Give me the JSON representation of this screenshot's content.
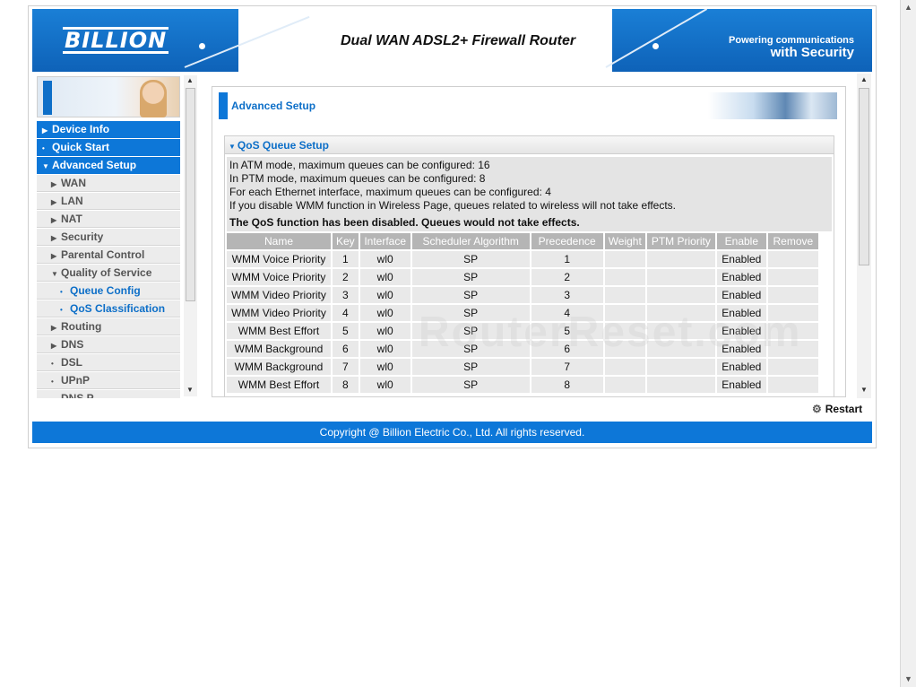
{
  "header": {
    "logo": "BILLION",
    "title": "Dual WAN ADSL2+ Firewall Router",
    "tagline_line1": "Powering communications",
    "tagline_line2": "with Security"
  },
  "menu": {
    "items": [
      {
        "label": "Device Info",
        "level": "top",
        "glyph": "▶"
      },
      {
        "label": "Quick Start",
        "level": "top",
        "glyph": "•"
      },
      {
        "label": "Advanced Setup",
        "level": "top",
        "glyph": "▼"
      },
      {
        "label": "WAN",
        "level": "sub",
        "glyph": "▶"
      },
      {
        "label": "LAN",
        "level": "sub",
        "glyph": "▶"
      },
      {
        "label": "NAT",
        "level": "sub",
        "glyph": "▶"
      },
      {
        "label": "Security",
        "level": "sub",
        "glyph": "▶"
      },
      {
        "label": "Parental Control",
        "level": "sub",
        "glyph": "▶"
      },
      {
        "label": "Quality of Service",
        "level": "sub",
        "glyph": "▼"
      },
      {
        "label": "Queue Config",
        "level": "sub2",
        "glyph": "•"
      },
      {
        "label": "QoS Classification",
        "level": "sub2",
        "glyph": "•"
      },
      {
        "label": "Routing",
        "level": "sub",
        "glyph": "▶"
      },
      {
        "label": "DNS",
        "level": "sub",
        "glyph": "▶"
      },
      {
        "label": "DSL",
        "level": "sub",
        "glyph": "•"
      },
      {
        "label": "UPnP",
        "level": "sub",
        "glyph": "•"
      },
      {
        "label": "DNS P",
        "level": "sub",
        "glyph": "•"
      }
    ]
  },
  "content": {
    "section_title": "Advanced Setup",
    "qos_title": "QoS Queue Setup",
    "info_lines": [
      "In ATM mode, maximum queues can be configured: 16",
      "In PTM mode, maximum queues can be configured: 8",
      "For each Ethernet interface, maximum queues can be configured: 4",
      "If you disable WMM function in Wireless Page, queues related to wireless will not take effects."
    ],
    "warning": "The QoS function has been disabled. Queues would not take effects.",
    "watermark": "RouterReset.com"
  },
  "table": {
    "headers": [
      "Name",
      "Key",
      "Interface",
      "Scheduler Algorithm",
      "Precedence",
      "Weight",
      "PTM Priority",
      "Enable",
      "Remove"
    ],
    "rows": [
      [
        "WMM Voice Priority",
        "1",
        "wl0",
        "SP",
        "1",
        "",
        "",
        "Enabled",
        ""
      ],
      [
        "WMM Voice Priority",
        "2",
        "wl0",
        "SP",
        "2",
        "",
        "",
        "Enabled",
        ""
      ],
      [
        "WMM Video Priority",
        "3",
        "wl0",
        "SP",
        "3",
        "",
        "",
        "Enabled",
        ""
      ],
      [
        "WMM Video Priority",
        "4",
        "wl0",
        "SP",
        "4",
        "",
        "",
        "Enabled",
        ""
      ],
      [
        "WMM Best Effort",
        "5",
        "wl0",
        "SP",
        "5",
        "",
        "",
        "Enabled",
        ""
      ],
      [
        "WMM Background",
        "6",
        "wl0",
        "SP",
        "6",
        "",
        "",
        "Enabled",
        ""
      ],
      [
        "WMM Background",
        "7",
        "wl0",
        "SP",
        "7",
        "",
        "",
        "Enabled",
        ""
      ],
      [
        "WMM Best Effort",
        "8",
        "wl0",
        "SP",
        "8",
        "",
        "",
        "Enabled",
        ""
      ]
    ]
  },
  "actions": {
    "restart": "Restart"
  },
  "footer": {
    "copyright": "Copyright @ Billion Electric Co., Ltd. All rights reserved."
  },
  "colors": {
    "accent": "#0d77d8",
    "menu_bg": "#ececec",
    "table_header": "#b5b5b5"
  }
}
